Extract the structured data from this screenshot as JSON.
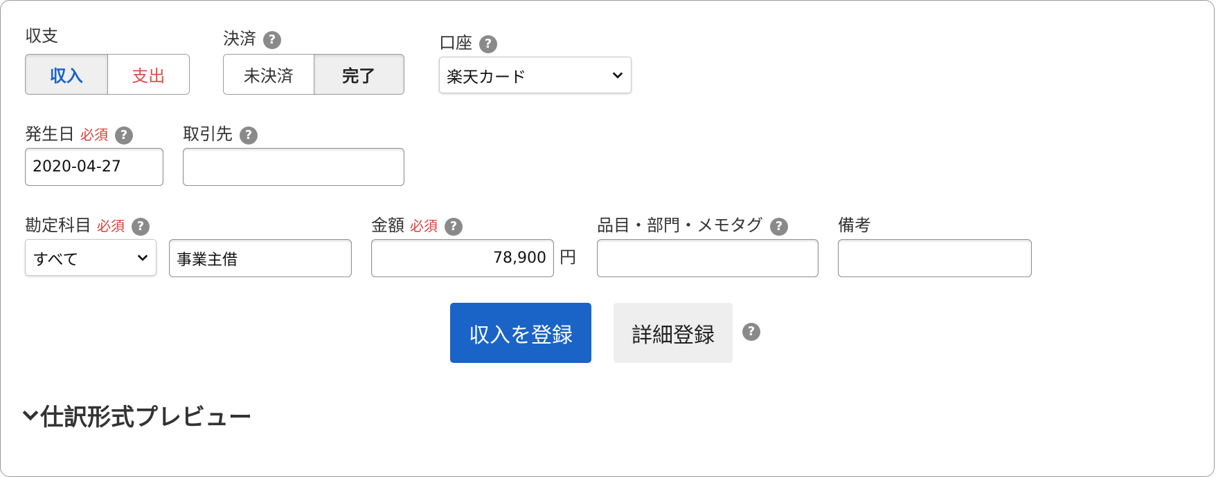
{
  "type_group": {
    "label": "収支",
    "options": [
      "収入",
      "支出"
    ],
    "selected": "収入"
  },
  "settlement": {
    "label": "決済",
    "options": [
      "未決済",
      "完了"
    ],
    "selected": "完了"
  },
  "account": {
    "label": "口座",
    "value": "楽天カード"
  },
  "date": {
    "label": "発生日",
    "required": "必須",
    "value": "2020-04-27"
  },
  "partner": {
    "label": "取引先",
    "value": ""
  },
  "account_item": {
    "label": "勘定科目",
    "required": "必須",
    "category": "すべて",
    "value": "事業主借"
  },
  "amount": {
    "label": "金額",
    "required": "必須",
    "value": "78,900",
    "unit": "円"
  },
  "tags": {
    "label": "品目・部門・メモタグ",
    "value": ""
  },
  "note": {
    "label": "備考",
    "value": ""
  },
  "actions": {
    "primary": "収入を登録",
    "secondary": "詳細登録"
  },
  "preview": {
    "label": "仕訳形式プレビュー"
  },
  "help_glyph": "?",
  "colors": {
    "primary": "#1a63c7",
    "income": "#1a63c7",
    "expense": "#e14b4b",
    "required": "#d9403a",
    "help": "#8a8a8a"
  }
}
